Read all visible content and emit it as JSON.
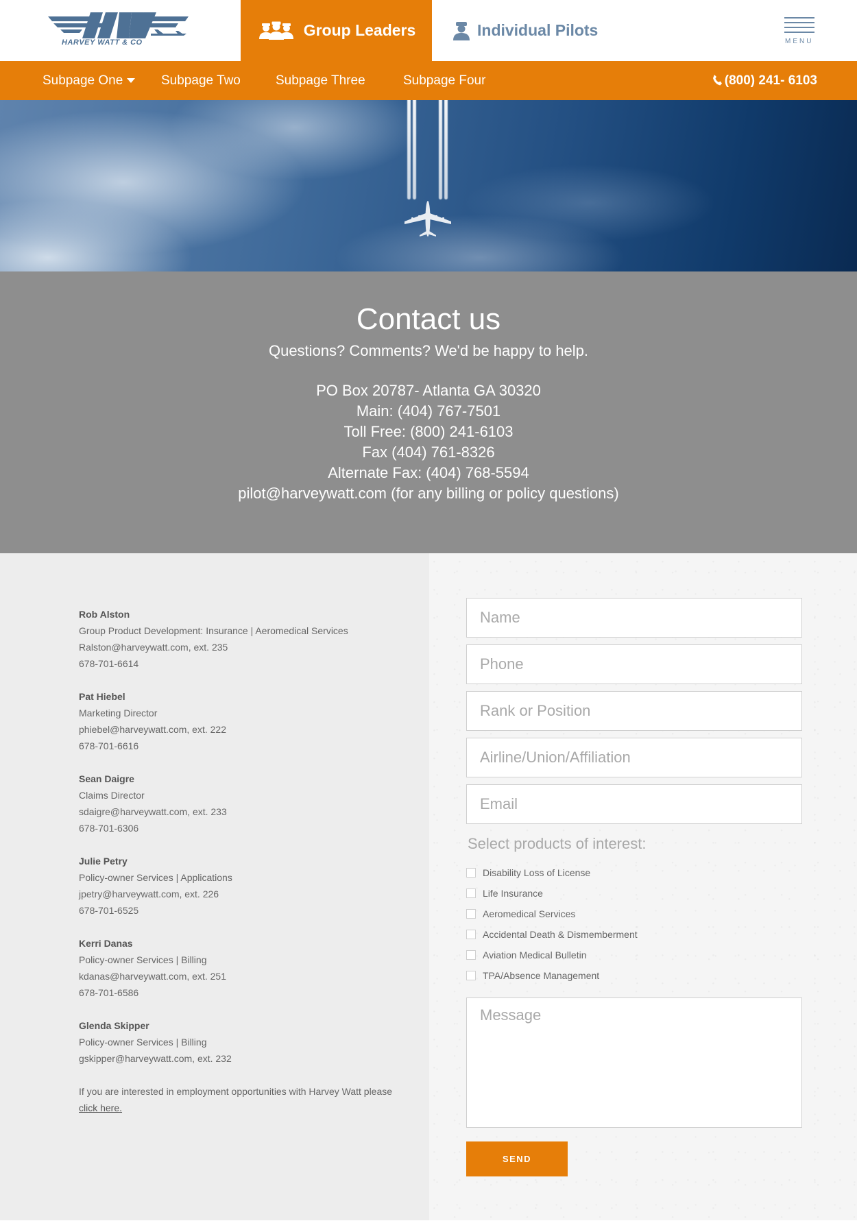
{
  "brand": {
    "logo_text": "HARVEY WATT & CO",
    "accent": "#e67e09",
    "steel_blue": "#6b88a6"
  },
  "header": {
    "group_leaders": {
      "label": "Group Leaders",
      "icon": "group-pilots-icon"
    },
    "individual_pilots": {
      "label": "Individual Pilots",
      "icon": "pilot-icon"
    },
    "menu_label": "MENU"
  },
  "subnav": {
    "items": [
      {
        "label": "Subpage One",
        "has_dropdown": true
      },
      {
        "label": "Subpage Two"
      },
      {
        "label": "Subpage Three"
      },
      {
        "label": "Subpage Four"
      }
    ],
    "phone": "(800) 241- 6103"
  },
  "intro": {
    "title": "Contact us",
    "subtitle": "Questions? Comments? We'd be happy to help.",
    "lines": [
      "PO Box 20787- Atlanta GA 30320",
      "Main: (404) 767-7501",
      "Toll Free: (800) 241-6103",
      "Fax (404) 761-8326",
      "Alternate Fax: (404) 768-5594",
      "pilot@harveywatt.com (for any billing or policy questions)"
    ]
  },
  "staff": [
    {
      "name": "Rob Alston",
      "role": "Group Product Development: Insurance | Aeromedical Services",
      "email": "Ralston@harveywatt.com, ext. 235",
      "phone": "678-701-6614"
    },
    {
      "name": "Pat Hiebel",
      "role": "Marketing Director",
      "email": "phiebel@harveywatt.com, ext. 222",
      "phone": "678-701-6616"
    },
    {
      "name": "Sean Daigre",
      "role": "Claims Director",
      "email": "sdaigre@harveywatt.com, ext. 233",
      "phone": "678-701-6306"
    },
    {
      "name": "Julie Petry",
      "role": "Policy-owner Services | Applications",
      "email": "jpetry@harveywatt.com, ext. 226",
      "phone": "678-701-6525"
    },
    {
      "name": "Kerri Danas",
      "role": "Policy-owner Services | Billing",
      "email": "kdanas@harveywatt.com, ext. 251",
      "phone": "678-701-6586"
    },
    {
      "name": "Glenda Skipper",
      "role": "Policy-owner Services | Billing",
      "email": "gskipper@harveywatt.com, ext. 232",
      "phone": ""
    }
  ],
  "employment": {
    "text": "If you are interested in employment opportunities with Harvey Watt please",
    "link": "click here."
  },
  "form": {
    "name_placeholder": "Name",
    "phone_placeholder": "Phone",
    "rank_placeholder": "Rank or Position",
    "airline_placeholder": "Airline/Union/Affiliation",
    "email_placeholder": "Email",
    "products_title": "Select products of interest:",
    "products": [
      "Disability Loss of License",
      "Life Insurance",
      "Aeromedical Services",
      "Accidental Death & Dismemberment",
      "Aviation Medical Bulletin",
      "TPA/Absence Management"
    ],
    "message_placeholder": "Message",
    "send_label": "SEND"
  }
}
